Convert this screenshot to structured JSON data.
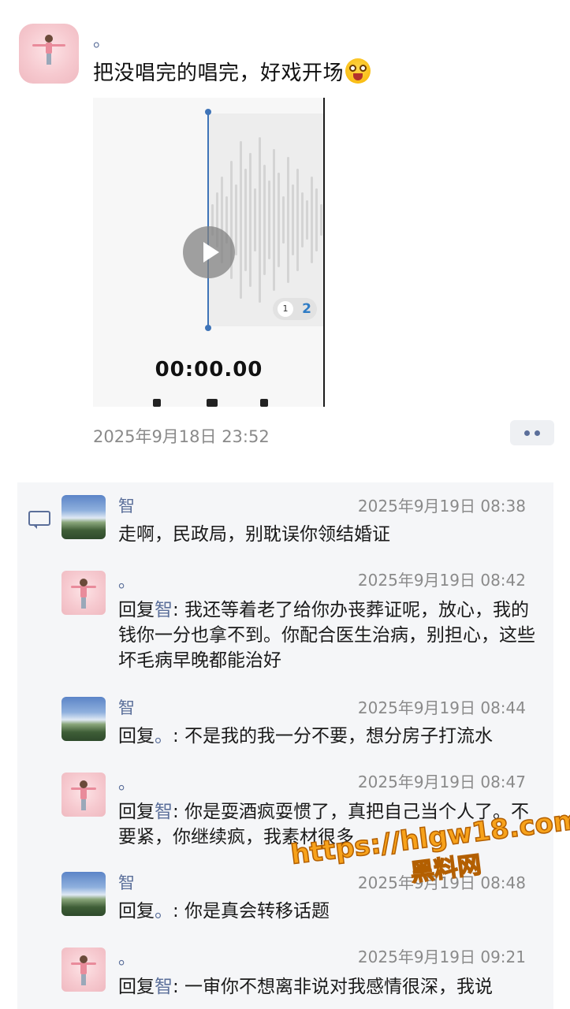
{
  "post": {
    "author": "。",
    "text": "把没唱完的唱完，好戏开场",
    "emoji": "shocked-face-emoji",
    "media": {
      "timer": "00:00.00",
      "pager_1": "1",
      "pager_2": "2",
      "play_icon": "play-icon"
    },
    "time": "2025年9月18日 23:52"
  },
  "comments": [
    {
      "name": "智",
      "time": "2025年9月19日 08:38",
      "avatar": "landscape",
      "reply_to": "",
      "text": "走啊，民政局，别耽误你领结婚证"
    },
    {
      "name": "。",
      "time": "2025年9月19日 08:42",
      "avatar": "doll",
      "reply_prefix": "回复",
      "reply_to": "智",
      "text": ": 我还等着老了给你办丧葬证呢，放心，我的钱你一分也拿不到。你配合医生治病，别担心，这些坏毛病早晚都能治好"
    },
    {
      "name": "智",
      "time": "2025年9月19日 08:44",
      "avatar": "landscape",
      "reply_prefix": "回复",
      "reply_to": "。",
      "text": ": 不是我的我一分不要，想分房子打流水"
    },
    {
      "name": "。",
      "time": "2025年9月19日 08:47",
      "avatar": "doll",
      "reply_prefix": "回复",
      "reply_to": "智",
      "text": ": 你是耍酒疯耍惯了，真把自己当个人了。不要紧，你继续疯，我素材很多"
    },
    {
      "name": "智",
      "time": "2025年9月19日 08:48",
      "avatar": "landscape",
      "reply_prefix": "回复",
      "reply_to": "。",
      "text": ": 你是真会转移话题"
    },
    {
      "name": "。",
      "time": "2025年9月19日 09:21",
      "avatar": "doll",
      "reply_prefix": "回复",
      "reply_to": "智",
      "text": ": 一审你不想离非说对我感情很深，我说"
    }
  ],
  "watermark": {
    "line1": "https://hlgw18.com",
    "line2": "黑料网"
  }
}
